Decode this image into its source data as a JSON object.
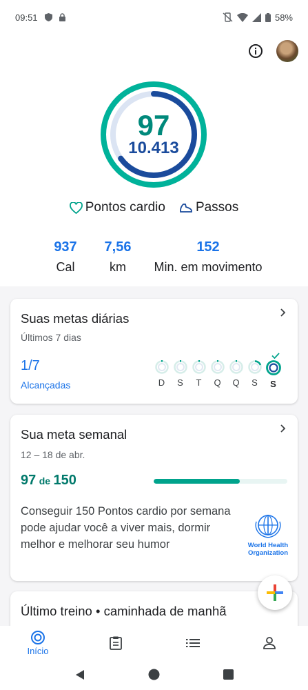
{
  "status_bar": {
    "time": "09:51",
    "battery": "58%"
  },
  "summary": {
    "cardio_points": "97",
    "steps": "10.413",
    "cardio_progress": 0.65,
    "steps_progress": 1.0,
    "legend_cardio": "Pontos cardio",
    "legend_steps": "Passos"
  },
  "stats": [
    {
      "value": "937",
      "label": "Cal"
    },
    {
      "value": "7,56",
      "label": "km"
    },
    {
      "value": "152",
      "label": "Min. em movimento"
    }
  ],
  "daily_goals": {
    "title": "Suas metas diárias",
    "subtitle": "Últimos 7 dias",
    "fraction": "1/7",
    "achieved_label": "Alcançadas",
    "days": [
      "D",
      "S",
      "T",
      "Q",
      "Q",
      "S",
      "S"
    ]
  },
  "weekly_goal": {
    "title": "Sua meta semanal",
    "date_range": "12 – 18 de abr.",
    "current": "97",
    "of_label": "de",
    "target": "150",
    "progress": 0.646,
    "description": "Conseguir 150 Pontos cardio por semana pode ajudar você a viver mais, dormir melhor e melhorar seu humor",
    "logo_line1": "World Health",
    "logo_line2": "Organization"
  },
  "last_workout": {
    "title": "Último treino • caminhada de manhã"
  },
  "bottom_nav": {
    "home_label": "Início"
  },
  "colors": {
    "teal": "#00a38c",
    "blue": "#1a4b9c",
    "link": "#1a73e8"
  }
}
